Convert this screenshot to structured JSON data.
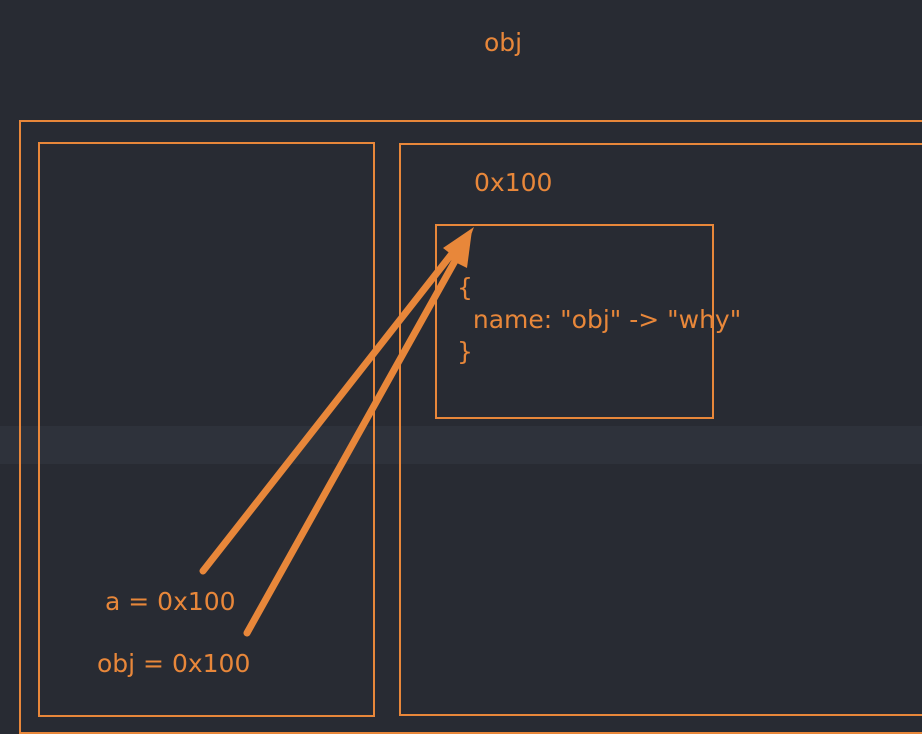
{
  "diagram": {
    "title": "obj",
    "heap_address": "0x100",
    "object_lines": [
      "{",
      "  name: \"obj\" -> \"why\"",
      "}"
    ],
    "stack_vars": [
      "a = 0x100",
      "obj = 0x100"
    ],
    "accent_color": "#e8873a",
    "background_color": "#282b33"
  }
}
